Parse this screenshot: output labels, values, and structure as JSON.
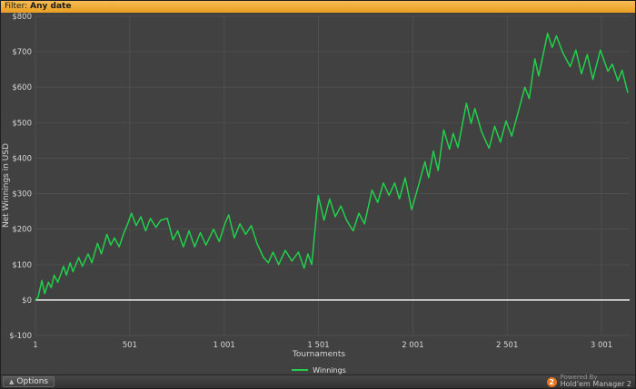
{
  "header": {
    "filter_label": "Filter:",
    "filter_value": "Any date"
  },
  "colors": {
    "accent_green": "#21d04b",
    "filter_bar_amber": "#eda62d",
    "brand_orange": "#e8721c",
    "zero_line": "#f2f2f2",
    "grid": "#4e4e4e"
  },
  "chart_data": {
    "type": "line",
    "title": "",
    "xlabel": "Tournaments",
    "ylabel": "Net Winnings in USD",
    "xlim": [
      1,
      3150
    ],
    "ylim": [
      -100,
      800
    ],
    "grid": true,
    "grid_color": "#4e4e4e",
    "legend_position": "bottom",
    "x_ticks": [
      {
        "value": 1,
        "label": "1"
      },
      {
        "value": 501,
        "label": "501"
      },
      {
        "value": 1001,
        "label": "1 001"
      },
      {
        "value": 1501,
        "label": "1 501"
      },
      {
        "value": 2001,
        "label": "2 001"
      },
      {
        "value": 2501,
        "label": "2 501"
      },
      {
        "value": 3001,
        "label": "3 001"
      }
    ],
    "y_ticks": [
      {
        "value": 800,
        "label": "$800"
      },
      {
        "value": 700,
        "label": "$700"
      },
      {
        "value": 600,
        "label": "$600"
      },
      {
        "value": 500,
        "label": "$500"
      },
      {
        "value": 400,
        "label": "$400"
      },
      {
        "value": 300,
        "label": "$300"
      },
      {
        "value": 200,
        "label": "$200"
      },
      {
        "value": 100,
        "label": "$100"
      },
      {
        "value": 0,
        "label": "$0"
      },
      {
        "value": -100,
        "label": "$-100"
      }
    ],
    "series": [
      {
        "name": "Winnings",
        "color": "#21d04b",
        "points": [
          [
            1,
            0
          ],
          [
            15,
            8
          ],
          [
            35,
            55
          ],
          [
            50,
            18
          ],
          [
            70,
            50
          ],
          [
            85,
            35
          ],
          [
            100,
            70
          ],
          [
            120,
            50
          ],
          [
            150,
            95
          ],
          [
            165,
            70
          ],
          [
            185,
            105
          ],
          [
            200,
            80
          ],
          [
            230,
            120
          ],
          [
            250,
            95
          ],
          [
            280,
            130
          ],
          [
            300,
            105
          ],
          [
            330,
            160
          ],
          [
            350,
            130
          ],
          [
            380,
            185
          ],
          [
            400,
            155
          ],
          [
            420,
            175
          ],
          [
            445,
            150
          ],
          [
            470,
            190
          ],
          [
            490,
            215
          ],
          [
            510,
            245
          ],
          [
            535,
            210
          ],
          [
            560,
            235
          ],
          [
            585,
            195
          ],
          [
            610,
            230
          ],
          [
            640,
            205
          ],
          [
            665,
            225
          ],
          [
            700,
            230
          ],
          [
            730,
            170
          ],
          [
            755,
            195
          ],
          [
            785,
            150
          ],
          [
            815,
            195
          ],
          [
            845,
            150
          ],
          [
            875,
            190
          ],
          [
            905,
            155
          ],
          [
            945,
            200
          ],
          [
            975,
            165
          ],
          [
            1005,
            215
          ],
          [
            1025,
            240
          ],
          [
            1055,
            175
          ],
          [
            1085,
            215
          ],
          [
            1115,
            185
          ],
          [
            1145,
            210
          ],
          [
            1175,
            160
          ],
          [
            1210,
            120
          ],
          [
            1235,
            105
          ],
          [
            1260,
            135
          ],
          [
            1290,
            100
          ],
          [
            1325,
            140
          ],
          [
            1360,
            110
          ],
          [
            1395,
            135
          ],
          [
            1425,
            90
          ],
          [
            1445,
            130
          ],
          [
            1465,
            100
          ],
          [
            1500,
            295
          ],
          [
            1530,
            225
          ],
          [
            1560,
            285
          ],
          [
            1590,
            235
          ],
          [
            1620,
            265
          ],
          [
            1650,
            225
          ],
          [
            1685,
            195
          ],
          [
            1715,
            245
          ],
          [
            1745,
            215
          ],
          [
            1785,
            310
          ],
          [
            1815,
            275
          ],
          [
            1845,
            330
          ],
          [
            1875,
            295
          ],
          [
            1905,
            330
          ],
          [
            1930,
            285
          ],
          [
            1960,
            345
          ],
          [
            1995,
            255
          ],
          [
            2035,
            330
          ],
          [
            2065,
            390
          ],
          [
            2085,
            345
          ],
          [
            2110,
            420
          ],
          [
            2135,
            365
          ],
          [
            2165,
            480
          ],
          [
            2195,
            425
          ],
          [
            2215,
            470
          ],
          [
            2240,
            430
          ],
          [
            2285,
            555
          ],
          [
            2310,
            498
          ],
          [
            2330,
            540
          ],
          [
            2365,
            475
          ],
          [
            2405,
            428
          ],
          [
            2435,
            490
          ],
          [
            2465,
            445
          ],
          [
            2495,
            505
          ],
          [
            2525,
            462
          ],
          [
            2595,
            600
          ],
          [
            2618,
            568
          ],
          [
            2648,
            680
          ],
          [
            2668,
            632
          ],
          [
            2715,
            752
          ],
          [
            2740,
            712
          ],
          [
            2762,
            745
          ],
          [
            2795,
            698
          ],
          [
            2835,
            658
          ],
          [
            2865,
            705
          ],
          [
            2895,
            638
          ],
          [
            2925,
            692
          ],
          [
            2955,
            622
          ],
          [
            2995,
            705
          ],
          [
            3035,
            645
          ],
          [
            3058,
            665
          ],
          [
            3088,
            618
          ],
          [
            3110,
            648
          ],
          [
            3140,
            585
          ]
        ]
      }
    ]
  },
  "footer": {
    "options_label": "Options",
    "powered_by": "Powered By",
    "brand": "Hold'em Manager 2",
    "brand_badge": "2"
  }
}
